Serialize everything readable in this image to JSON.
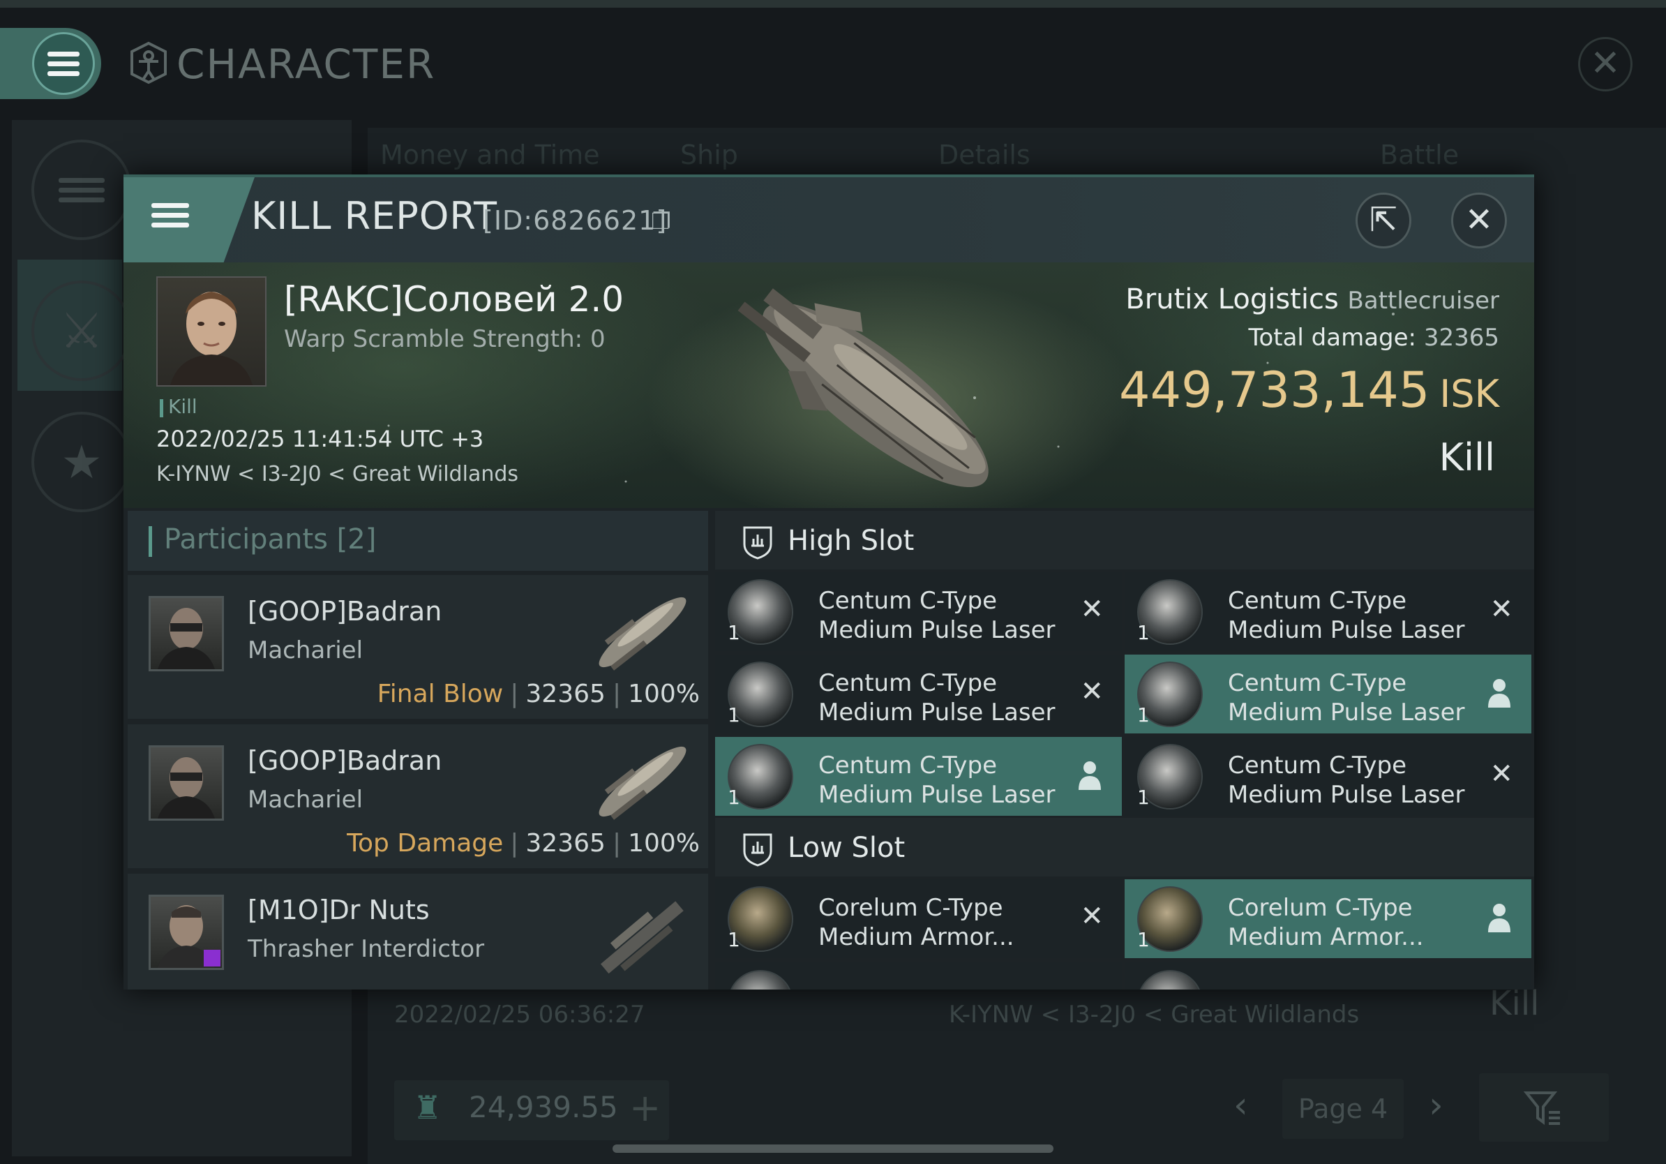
{
  "app": {
    "title": "CHARACTER",
    "tabs": [
      "Money and Time",
      "Ship",
      "Details",
      "Battle Status"
    ],
    "bg_row": {
      "time": "2022/02/25  06:36:27",
      "location": "K-IYNW < I3-2J0 < Great Wildlands",
      "result": "Kill"
    },
    "bottom": {
      "isk": "24,939.55",
      "page": "Page 4"
    }
  },
  "kill_report": {
    "title": "KILL REPORT",
    "id": "[ID:6826621]",
    "victim": {
      "name": "[RAKC]Соловей 2.0",
      "warp_scramble": "Warp Scramble Strength: 0",
      "tag": "Kill",
      "time": "2022/02/25 11:41:54 UTC +3",
      "location": "K-IYNW < I3-2J0 < Great Wildlands"
    },
    "ship": {
      "name": "Brutix Logistics",
      "class": "Battlecruiser"
    },
    "total_damage_label": "Total damage:",
    "total_damage": "32365",
    "isk_value": "449,733,145",
    "isk_unit": "ISK",
    "result": "Kill",
    "participants_title": "Participants [2]",
    "participants": [
      {
        "name": "[GOOP]Badran",
        "ship": "Machariel",
        "label": "Final Blow",
        "damage": "32365",
        "percent": "100%"
      },
      {
        "name": "[GOOP]Badran",
        "ship": "Machariel",
        "label": "Top Damage",
        "damage": "32365",
        "percent": "100%"
      },
      {
        "name": "[M1O]Dr Nuts",
        "ship": "Thrasher Interdictor"
      }
    ],
    "high_slot_label": "High Slot",
    "high_slot": [
      {
        "name1": "Centum C-Type",
        "name2": "Medium Pulse Laser",
        "qty": "1",
        "state": "destroyed",
        "glyph": "✕"
      },
      {
        "name1": "Centum C-Type",
        "name2": "Medium Pulse Laser",
        "qty": "1",
        "state": "destroyed",
        "glyph": "✕"
      },
      {
        "name1": "Centum C-Type",
        "name2": "Medium Pulse Laser",
        "qty": "1",
        "state": "destroyed",
        "glyph": "✕"
      },
      {
        "name1": "Centum C-Type",
        "name2": "Medium Pulse Laser",
        "qty": "1",
        "state": "dropped",
        "glyph": ""
      },
      {
        "name1": "Centum C-Type",
        "name2": "Medium Pulse Laser",
        "qty": "1",
        "state": "dropped",
        "glyph": ""
      },
      {
        "name1": "Centum C-Type",
        "name2": "Medium Pulse Laser",
        "qty": "1",
        "state": "destroyed",
        "glyph": "✕"
      }
    ],
    "low_slot_label": "Low Slot",
    "low_slot": [
      {
        "name1": "Corelum C-Type",
        "name2": "Medium Armor...",
        "qty": "1",
        "state": "destroyed",
        "glyph": "✕"
      },
      {
        "name1": "Corelum C-Type",
        "name2": "Medium Armor...",
        "qty": "1",
        "state": "dropped",
        "glyph": ""
      }
    ]
  },
  "colors": {
    "accent": "#4b7a72",
    "isk": "#e6c98d",
    "final_blow": "#d7a75c",
    "dropped": "#3d7068"
  }
}
